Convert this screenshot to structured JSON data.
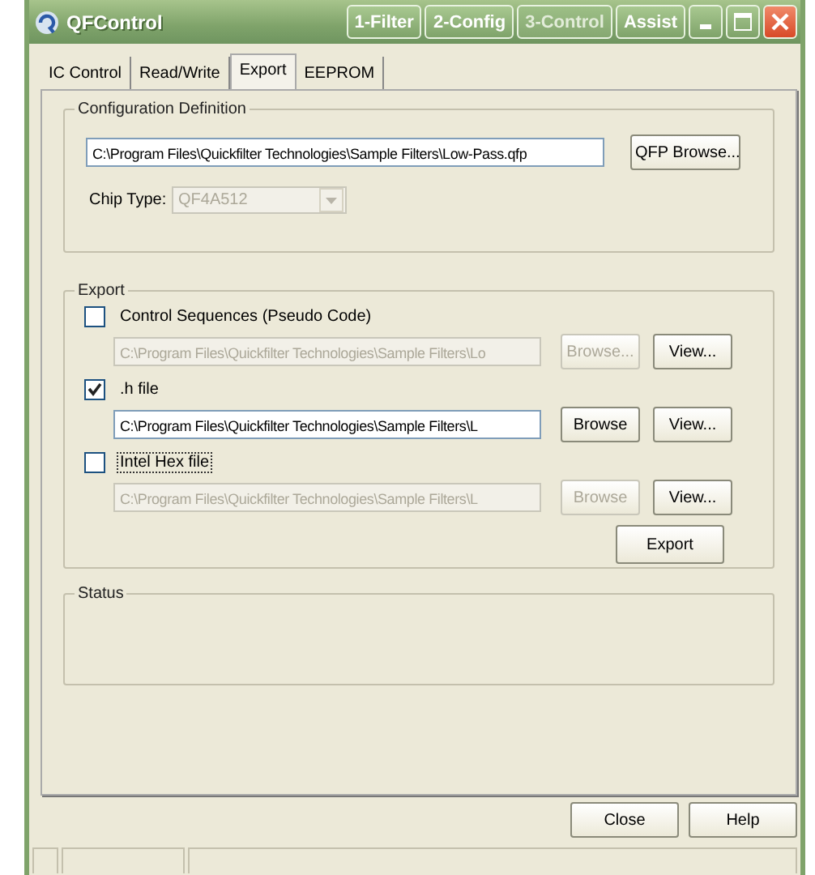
{
  "window": {
    "title": "QFControl",
    "title_buttons": [
      {
        "label": "1-Filter",
        "disabled": false
      },
      {
        "label": "2-Config",
        "disabled": false
      },
      {
        "label": "3-Control",
        "disabled": true
      },
      {
        "label": "Assist",
        "disabled": false
      }
    ]
  },
  "tabs": [
    {
      "label": "IC Control",
      "selected": false
    },
    {
      "label": "Read/Write",
      "selected": false
    },
    {
      "label": "Export",
      "selected": true
    },
    {
      "label": "EEPROM",
      "selected": false
    }
  ],
  "configuration": {
    "title": "Configuration Definition",
    "file_path": "C:\\Program Files\\Quickfilter Technologies\\Sample Filters\\Low-Pass.qfp",
    "browse_button": "QFP Browse...",
    "chip_type_label": "Chip Type:",
    "chip_type": {
      "value": "QF4A512",
      "disabled": true
    }
  },
  "export": {
    "title": "Export",
    "items": [
      {
        "label": "Control Sequences (Pseudo Code)",
        "checked": false,
        "focused": false,
        "path": "C:\\Program Files\\Quickfilter Technologies\\Sample Filters\\Lo",
        "browse": "Browse...",
        "view": "View..."
      },
      {
        "label": ".h file",
        "checked": true,
        "focused": false,
        "path": "C:\\Program Files\\Quickfilter Technologies\\Sample Filters\\L",
        "browse": "Browse",
        "view": "View..."
      },
      {
        "label": "Intel Hex file",
        "checked": false,
        "focused": true,
        "path": "C:\\Program Files\\Quickfilter Technologies\\Sample Filters\\L",
        "browse": "Browse",
        "view": "View..."
      }
    ],
    "export_button": "Export"
  },
  "status": {
    "title": "Status"
  },
  "buttons": [
    "Close",
    "Help"
  ]
}
